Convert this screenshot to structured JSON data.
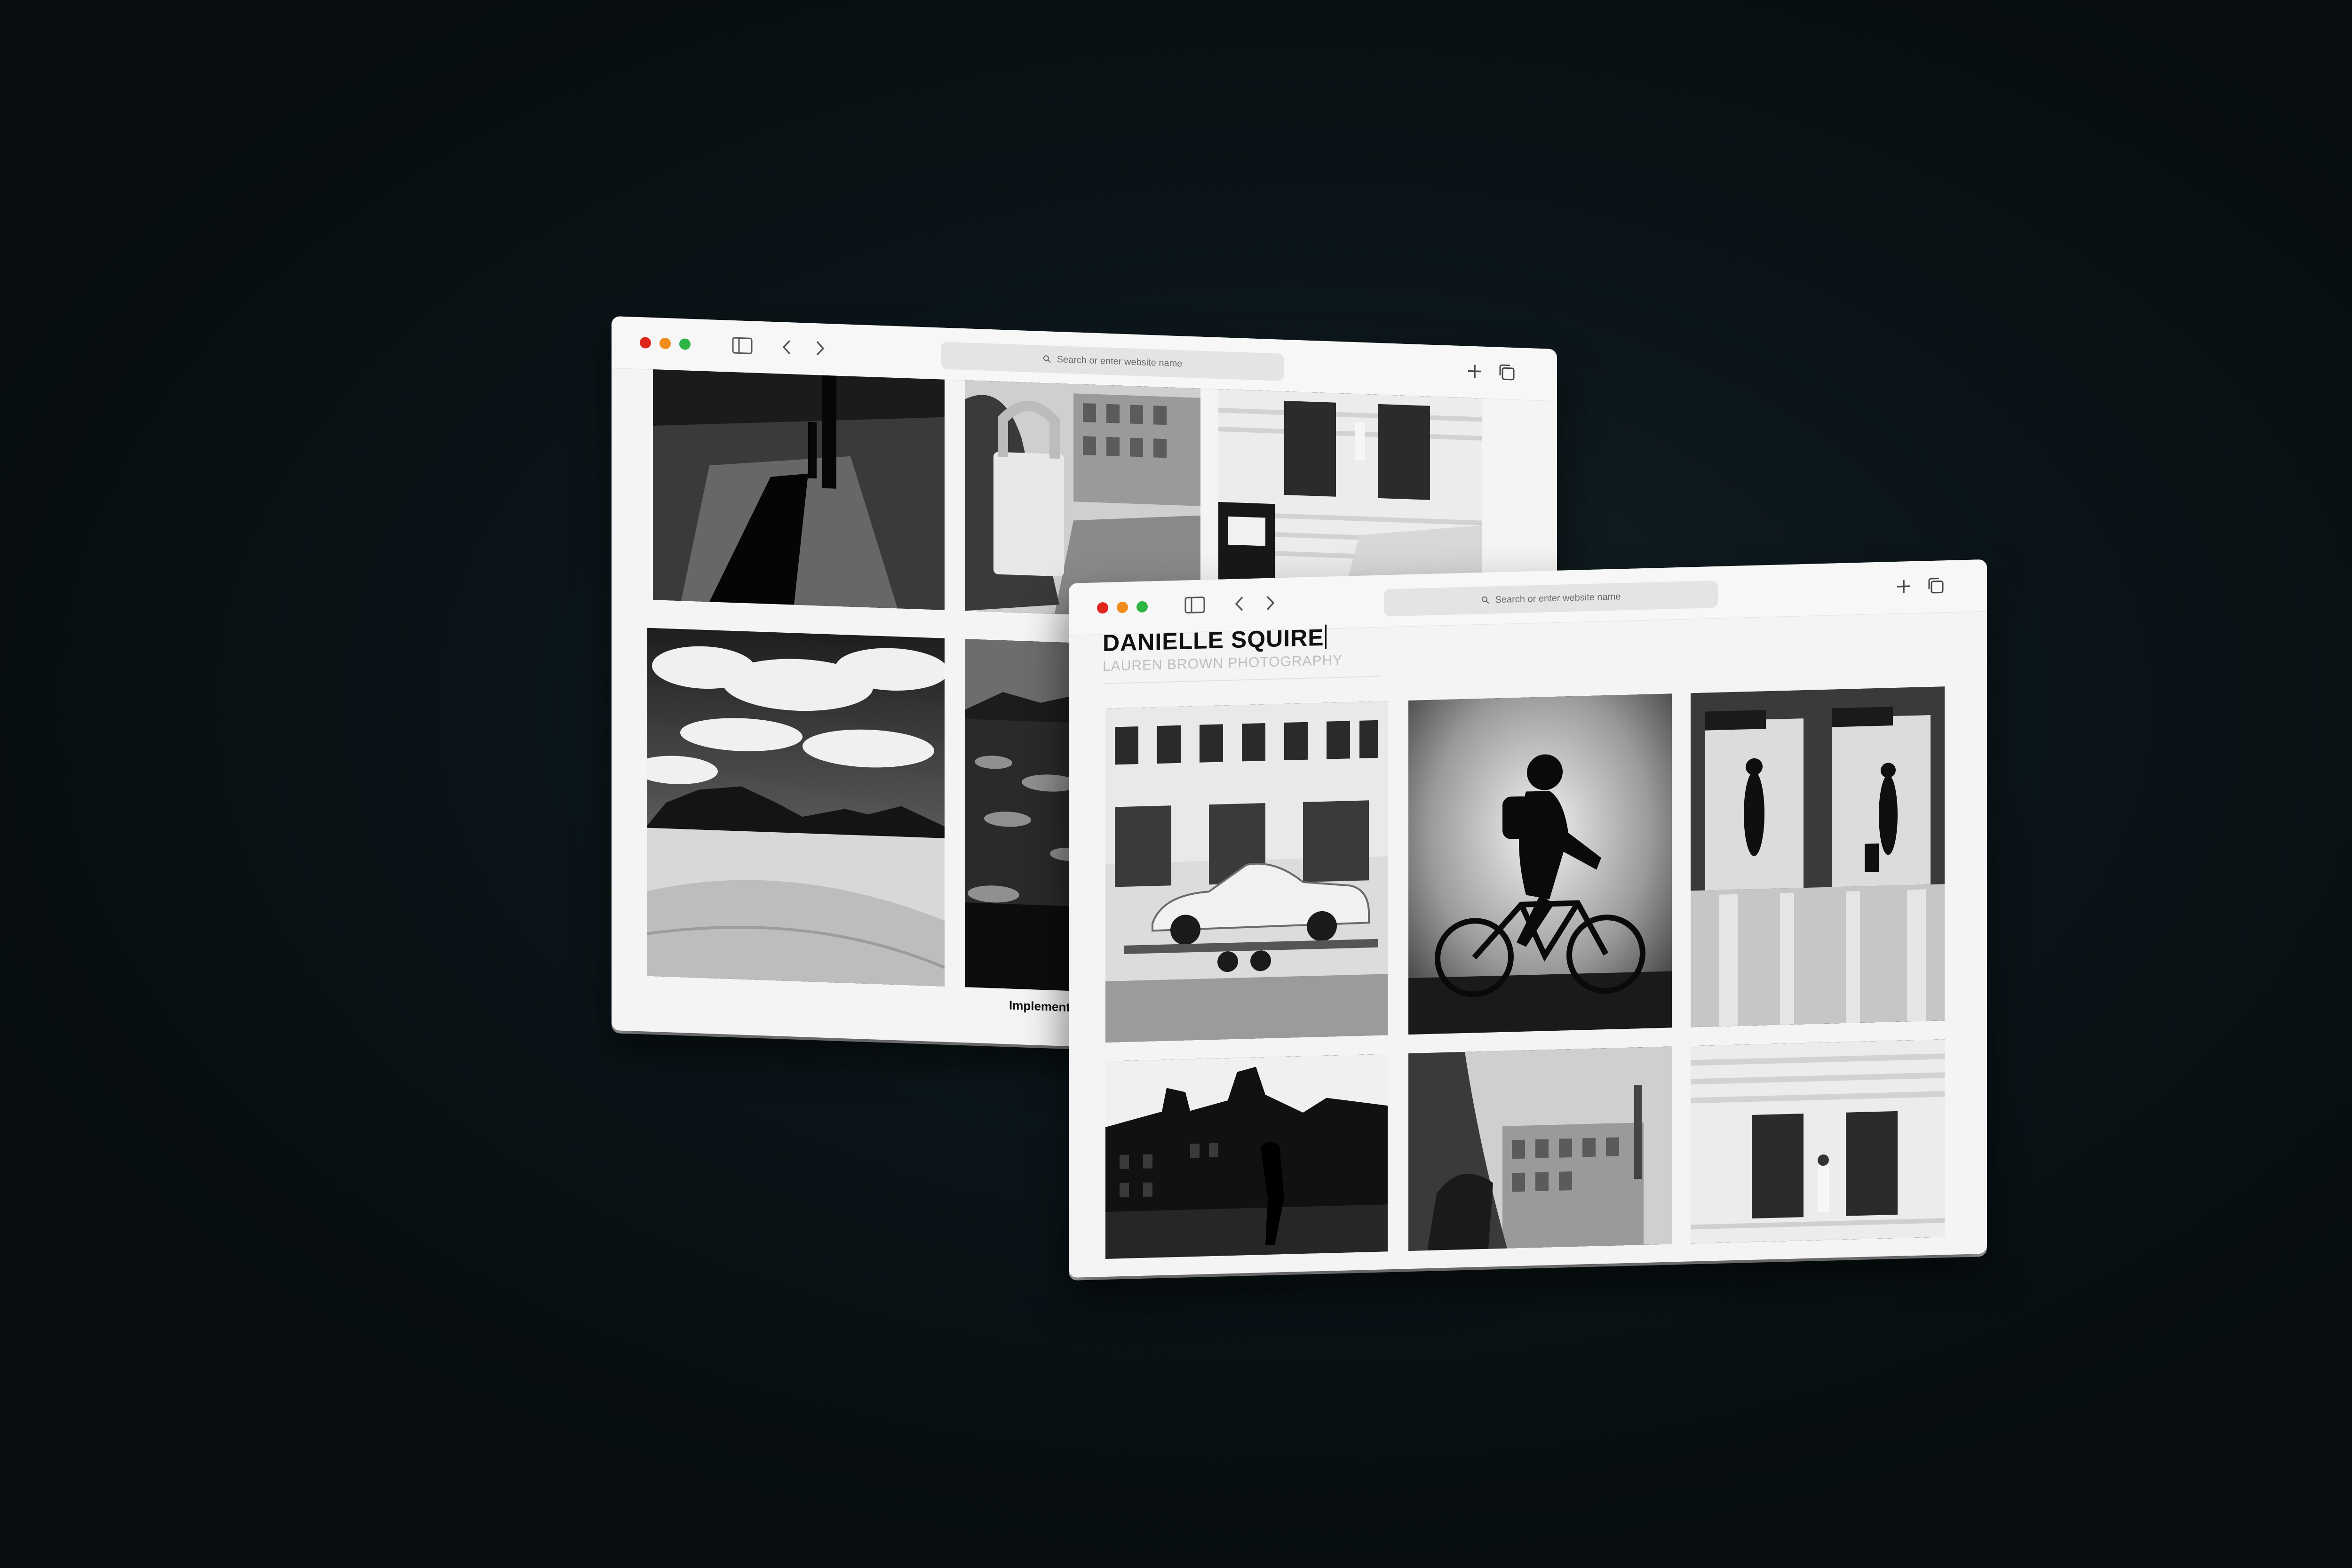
{
  "back_window": {
    "address_placeholder": "Search or enter website name",
    "caption": "Implement"
  },
  "front_window": {
    "address_placeholder": "Search or enter website name",
    "site_title": "DANIELLE SQUIRE",
    "site_subtitle": "LAUREN BROWN PHOTOGRAPHY"
  },
  "icons": {
    "sidebar": "sidebar-icon",
    "back": "chevron-left-icon",
    "forward": "chevron-right-icon",
    "search": "magnifier-icon",
    "new_tab": "plus-icon",
    "tabs": "tabs-overview-icon"
  },
  "colors": {
    "close": "#e0251d",
    "minimize": "#f28c1c",
    "zoom": "#2fb545",
    "page_bg": "#f4f4f4"
  }
}
